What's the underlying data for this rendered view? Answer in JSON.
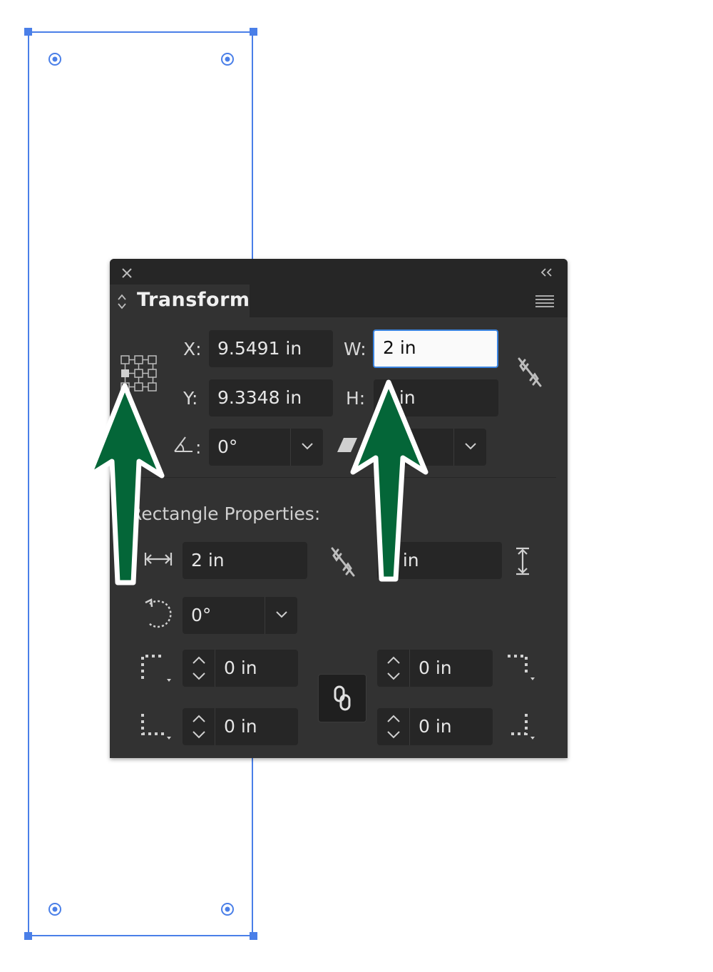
{
  "panel": {
    "title": "Transform",
    "x_label": "X:",
    "x_value": "9.5491 in",
    "y_label": "Y:",
    "y_value": "9.3348 in",
    "w_label": "W:",
    "w_value": "2 in",
    "h_label": "H:",
    "h_value": "8 in",
    "rotation_label": ":",
    "rotation_value": "0°",
    "shear_value": "0°"
  },
  "rectangle_properties": {
    "section_title": "Rectangle Properties:",
    "width_value": "2 in",
    "height_value": "8 in",
    "rotation_value": "0°",
    "corner_top_left": "0 in",
    "corner_top_right": "0 in",
    "corner_bottom_left": "0 in",
    "corner_bottom_right": "0 in"
  },
  "colors": {
    "selection": "#4a7fe8",
    "arrow_fill": "#046638",
    "panel_bg": "#323232",
    "field_bg": "#262626",
    "focus_border": "#3b84e0"
  },
  "icons": [
    "close-icon",
    "collapse-panel-icon",
    "panel-expand-icon",
    "panel-menu-icon",
    "reference-point-icon",
    "constrain-proportions-icon",
    "rotate-icon",
    "shear-icon",
    "width-icon",
    "height-icon",
    "rotation-arrow-icon",
    "corner-top-left-icon",
    "corner-top-right-icon",
    "corner-bottom-left-icon",
    "corner-bottom-right-icon",
    "link-corners-icon",
    "chevron-down-icon",
    "stepper-icon"
  ]
}
